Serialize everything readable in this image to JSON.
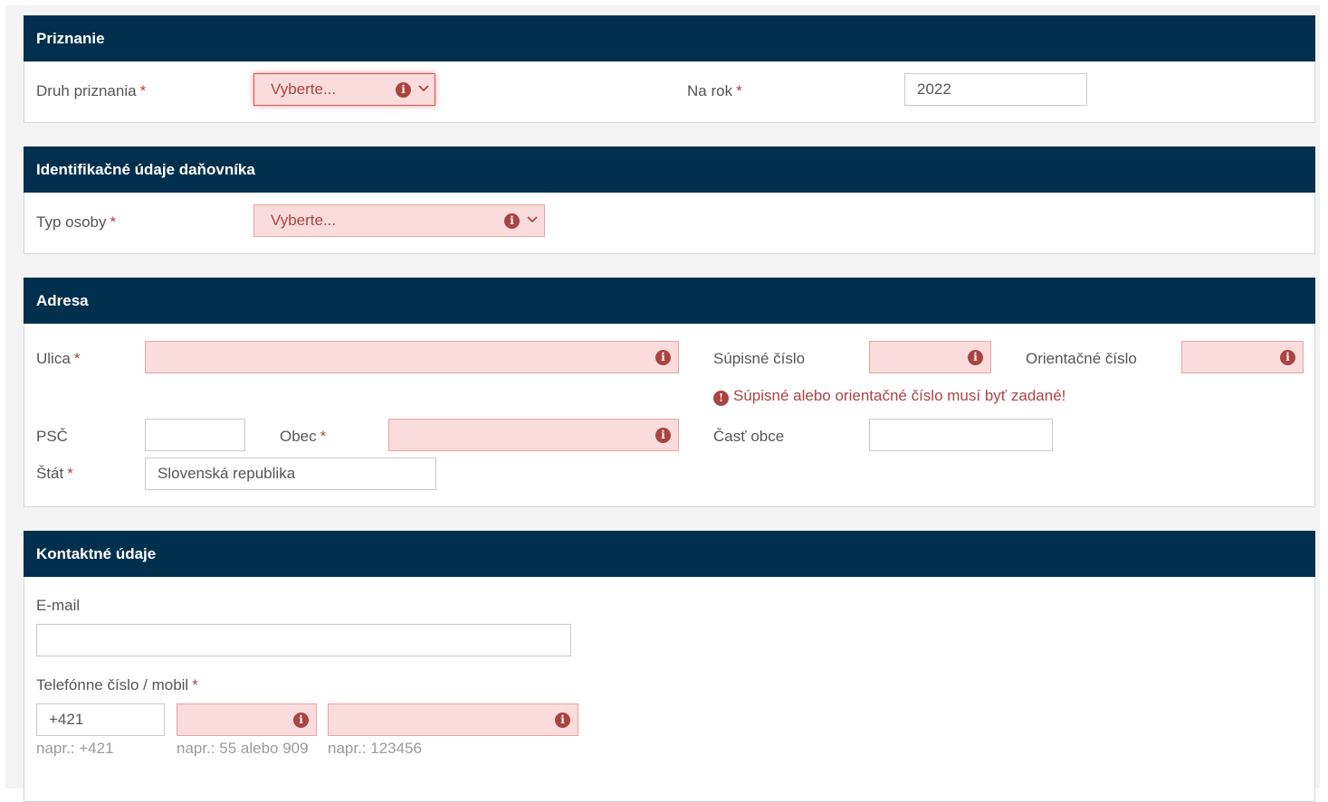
{
  "priznanie": {
    "title": "Priznanie",
    "druh_label": "Druh priznania",
    "druh_value": "Vyberte...",
    "rok_label": "Na rok",
    "rok_value": "2022",
    "required_mark": "*"
  },
  "identifikacia": {
    "title": "Identifikačné údaje daňovníka",
    "typ_label": "Typ osoby",
    "typ_value": "Vyberte...",
    "required_mark": "*"
  },
  "adresa": {
    "title": "Adresa",
    "ulica_label": "Ulica",
    "ulica_value": "",
    "supisne_label": "Súpisné číslo",
    "supisne_value": "",
    "orientacne_label": "Orientačné číslo",
    "orientacne_value": "",
    "error_message": "Súpisné alebo orientačné číslo musí byť zadané!",
    "psc_label": "PSČ",
    "psc_value": "",
    "obec_label": "Obec",
    "obec_value": "",
    "cast_obce_label": "Časť obce",
    "cast_obce_value": "",
    "stat_label": "Štát",
    "stat_value": "Slovenská republika",
    "required_mark": "*"
  },
  "kontakt": {
    "title": "Kontaktné údaje",
    "email_label": "E-mail",
    "email_value": "",
    "telefon_label": "Telefónne číslo / mobil",
    "required_mark": "*",
    "prefix_value": "+421",
    "area_value": "",
    "number_value": "",
    "prefix_hint": "napr.: +421",
    "area_hint": "napr.: 55 alebo 909",
    "number_hint": "napr.: 123456"
  },
  "icons": {
    "error": "exclamation-circle",
    "dropdown": "chevron-down"
  },
  "colors": {
    "header_bg": "#00304d",
    "error": "#a94442",
    "error_bg": "#fadcdc"
  }
}
